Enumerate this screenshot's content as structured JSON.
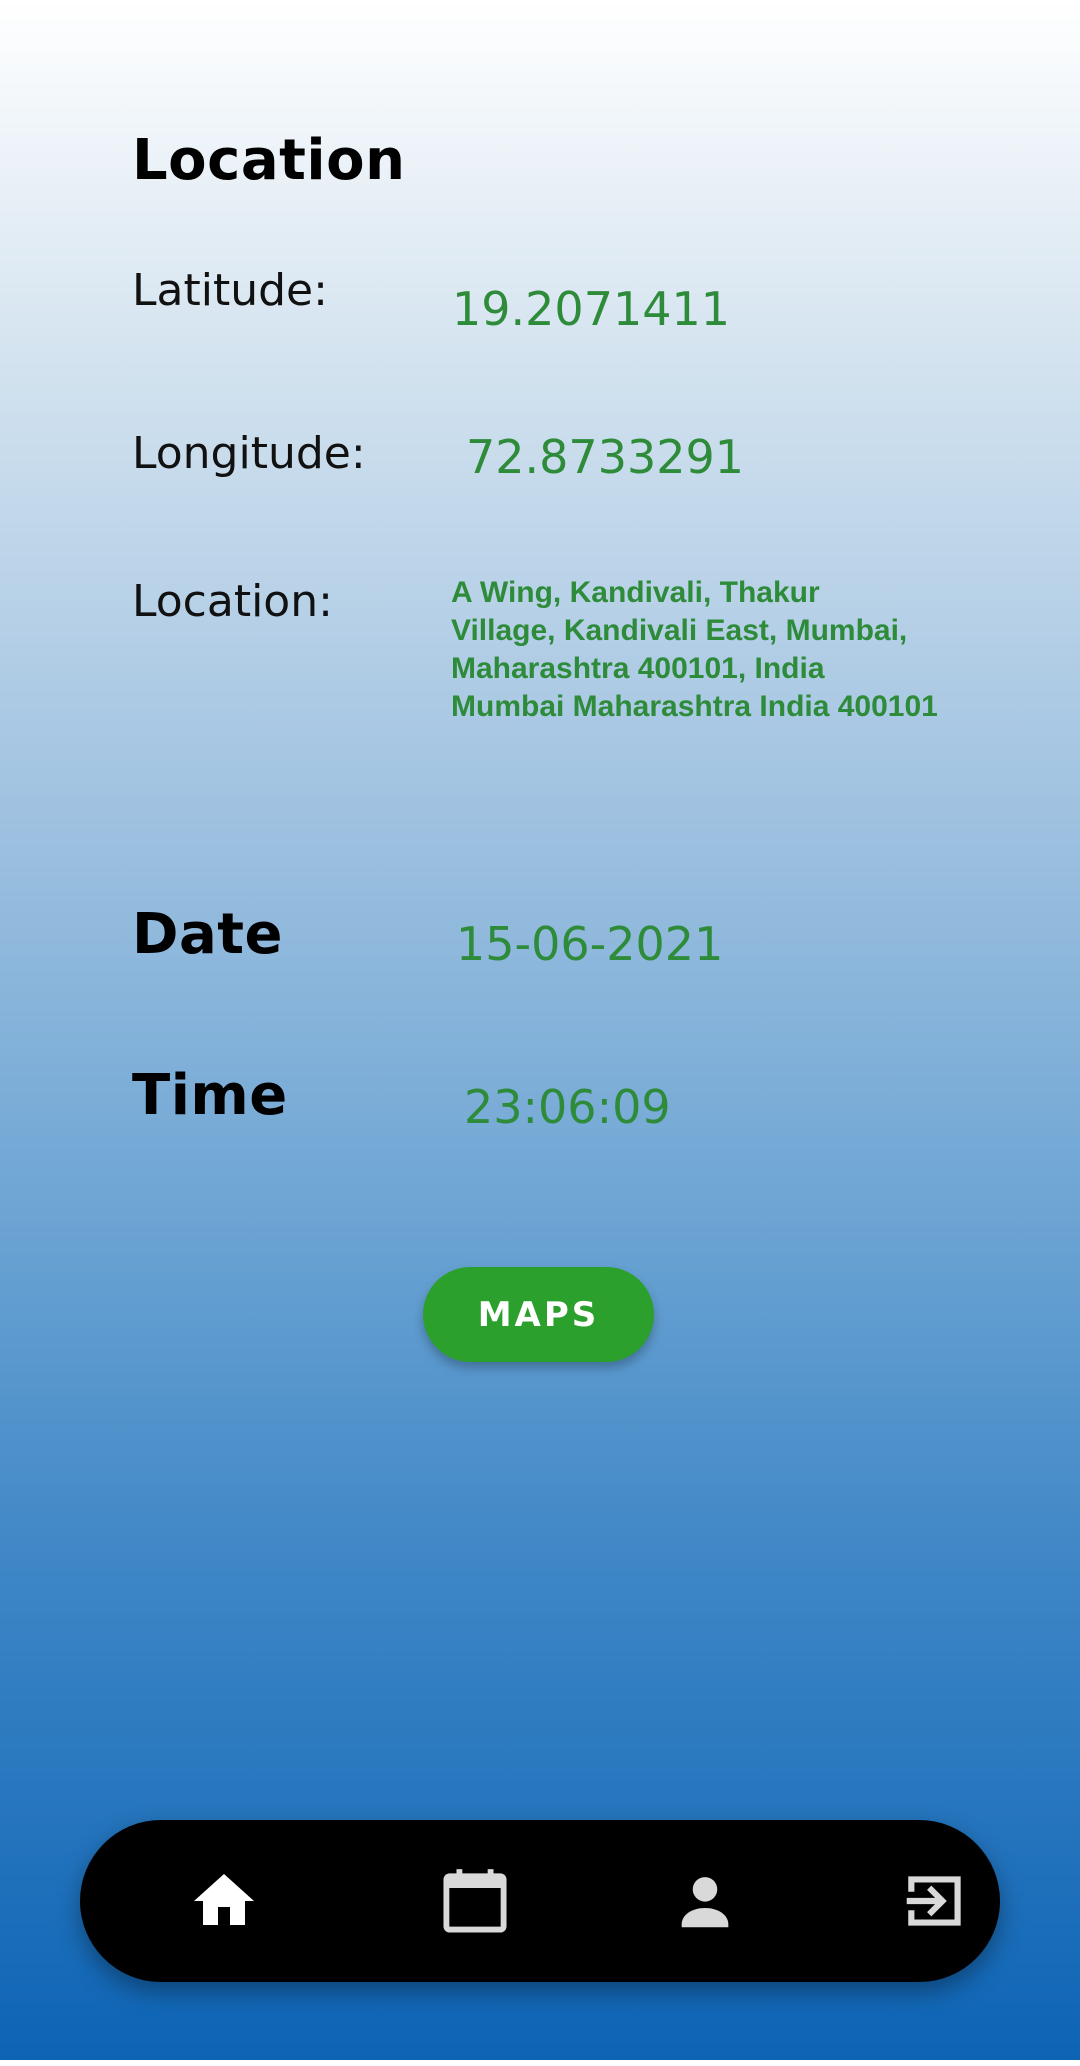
{
  "location_section": {
    "heading": "Location",
    "latitude_label": "Latitude:",
    "latitude_value": "19.2071411",
    "longitude_label": "Longitude:",
    "longitude_value": "72.8733291",
    "location_label": "Location:",
    "address_lines": [
      "A Wing, Kandivali, Thakur",
      "Village, Kandivali East, Mumbai,",
      "Maharashtra 400101, India",
      "Mumbai Maharashtra India 400101"
    ]
  },
  "date_section": {
    "heading": "Date",
    "value": "15-06-2021"
  },
  "time_section": {
    "heading": "Time",
    "value": "23:06:09"
  },
  "maps_button": {
    "label": "MAPS"
  },
  "bottom_nav": {
    "items": [
      {
        "icon": "home-icon",
        "active": true
      },
      {
        "icon": "calendar-icon",
        "active": false
      },
      {
        "icon": "person-icon",
        "active": false
      },
      {
        "icon": "logout-icon",
        "active": false
      }
    ]
  },
  "colors": {
    "value_green": "#2e8b3a",
    "button_green": "#2ca02c",
    "nav_background": "#000000",
    "nav_active_icon": "#ffffff",
    "nav_inactive_icon": "#d9d9d9"
  }
}
